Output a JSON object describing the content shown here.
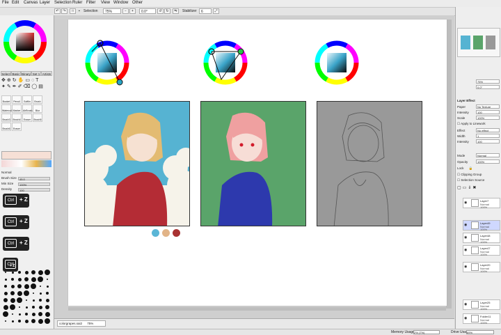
{
  "menus": [
    "File",
    "Edit",
    "Canvas",
    "Layer",
    "Selection",
    "Ruler",
    "Filter",
    "View",
    "Window",
    "Other"
  ],
  "toolbar": {
    "selection_label": "Selection",
    "zoom_value": "75%",
    "rotation_value": "0.0°",
    "stabilizer_label": "Stabilizer",
    "stabilizer_value": "6"
  },
  "tool_tabs": [
    "Select",
    "Basic",
    "Binary",
    "Set 1",
    "Artists"
  ],
  "tools": [
    "Bucket",
    "Pencil",
    "Softlin",
    "Brush",
    "Watercol",
    "Marker",
    "AirBrush",
    "Blur",
    "Brush3",
    "Brush4",
    "Eraser",
    "Brush5",
    "Brush6",
    "Eraser"
  ],
  "brush_props": {
    "blend_mode": "Normal",
    "brush_size_label": "Brush Size",
    "brush_size_value": "45.0",
    "min_size_label": "Min Size",
    "min_size_value": "100%",
    "density_label": "Density",
    "density_value": "100"
  },
  "shortcuts": [
    {
      "key": "Ctrl",
      "op": "+ Z"
    },
    {
      "key": "Ctrl",
      "op": "+ Z"
    },
    {
      "key": "Ctrl",
      "op": "+ Z"
    },
    {
      "key": "Ctrl",
      "op": "+ Z"
    }
  ],
  "palette_swatches": [
    "#5bb6d6",
    "#e2b487",
    "#a83232"
  ],
  "doc_tab": {
    "name": "colorgrapes.sai2",
    "zoom": "75%"
  },
  "status": {
    "memory_label": "Memory Usage",
    "memory_value": "2% (7%)",
    "drive_label": "Drive Usage",
    "drive_value": "69%"
  },
  "navigator": {
    "zoom": "75%",
    "angle": "0.0°"
  },
  "layer_props": {
    "effect_header": "Layer Effect",
    "paper_label": "Paper",
    "paper_value": "No Texture",
    "intensity_label": "Intensity",
    "intensity_value": "100",
    "scale_label": "Scale",
    "scale_value": "100%",
    "apply_label": "Apply to Linework",
    "effect_label": "Effect",
    "effect_value": "No effect",
    "width_label": "Width",
    "width_value": "1",
    "intensity2_label": "Intensity",
    "intensity2_value": "100",
    "mode_label": "Mode",
    "mode_value": "Normal",
    "opacity_label": "Opacity",
    "opacity_value": "100%",
    "lock_label": "Lock",
    "clipping_label": "Clipping Group",
    "selection_source_label": "Selection Source"
  },
  "layers": [
    {
      "name": "Layer7",
      "mode": "Normal",
      "opacity": "100%"
    },
    {
      "name": "Layer49",
      "mode": "Normal",
      "opacity": "100%"
    },
    {
      "name": "Layer48",
      "mode": "Normal",
      "opacity": "100%"
    },
    {
      "name": "Layer47",
      "mode": "Normal",
      "opacity": "100%"
    },
    {
      "name": "Layer20",
      "mode": "Normal",
      "opacity": "100%"
    },
    {
      "name": "Layer25",
      "mode": "Normal",
      "opacity": "100%"
    },
    {
      "name": "Folder11",
      "mode": "Normal",
      "opacity": "100%"
    }
  ],
  "colors": {
    "panel1_bg": "#56b3d2",
    "panel2_bg": "#5aa46a",
    "panel3_bg": "#999999",
    "hair1": "#e3bb72",
    "hair2": "#efa0a0",
    "hoodie1": "#b42c35",
    "hoodie2": "#2d39ad"
  }
}
